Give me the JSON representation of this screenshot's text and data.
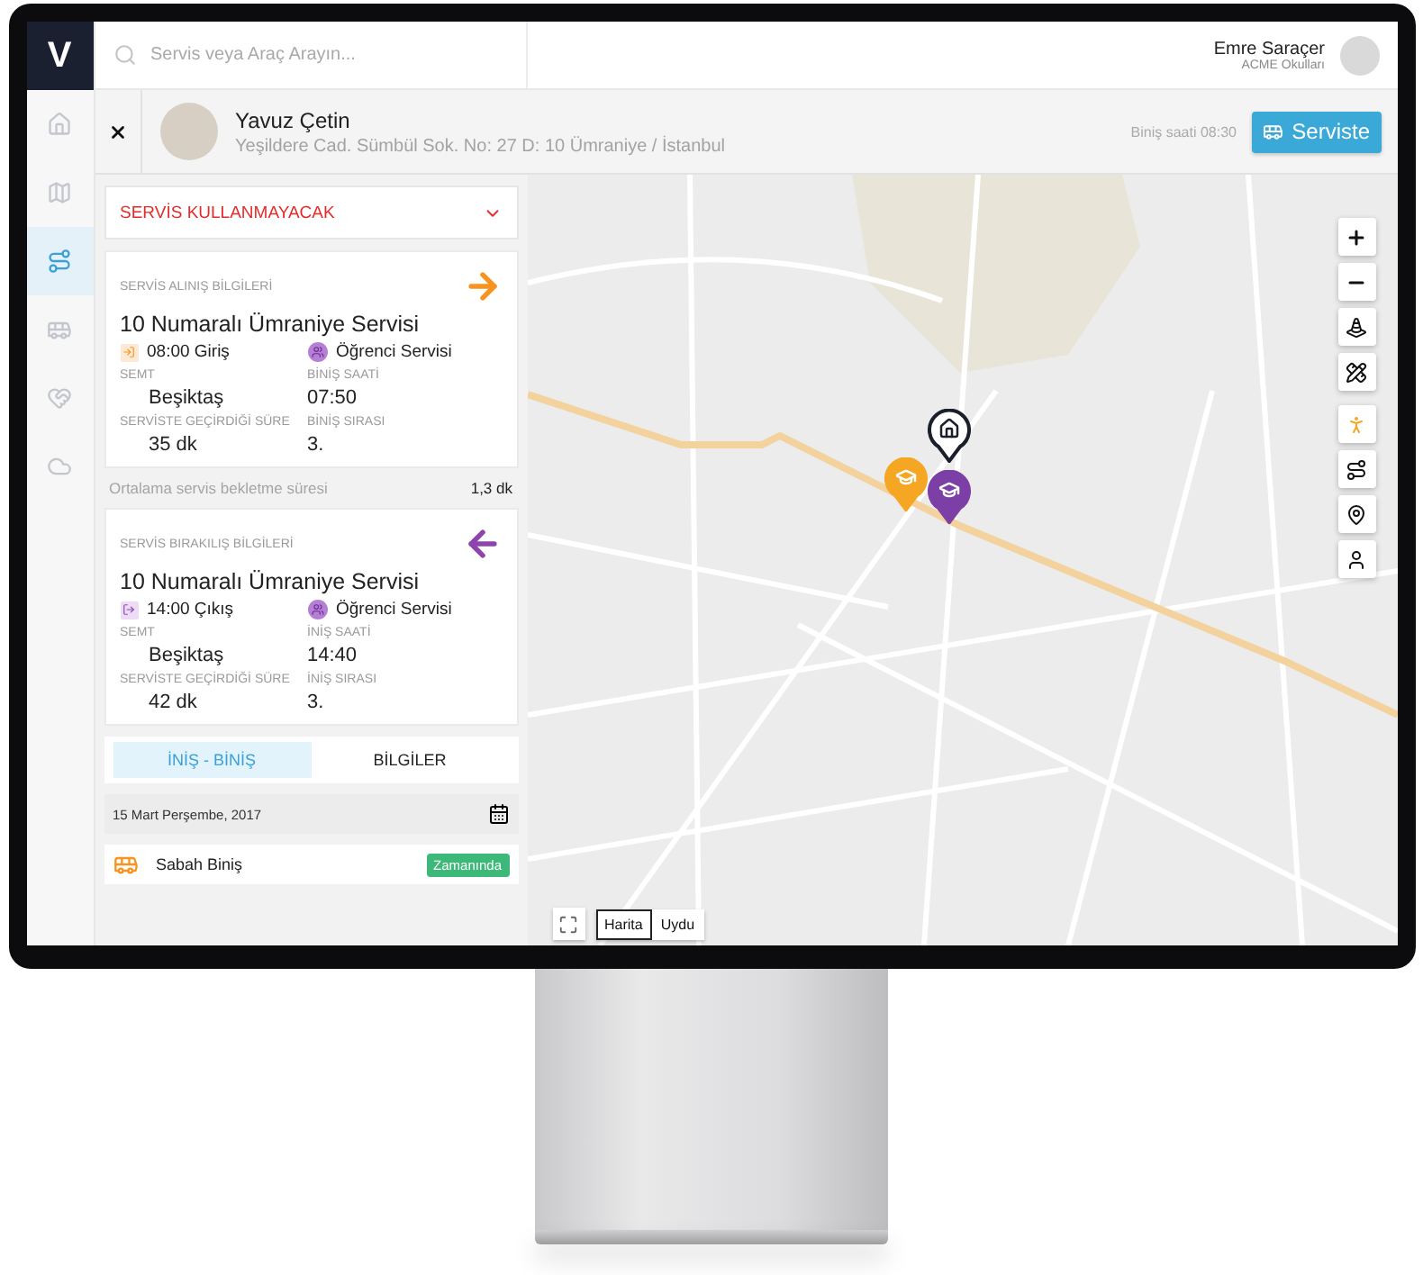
{
  "logo": "V",
  "sidebar": {
    "items": [
      {
        "selected": false
      },
      {
        "selected": false
      },
      {
        "selected": true
      },
      {
        "selected": false
      },
      {
        "selected": false
      },
      {
        "selected": false
      }
    ]
  },
  "search": {
    "placeholder": "Servis veya Araç Arayın..."
  },
  "user": {
    "name": "Emre Saraçer",
    "organization": "ACME Okulları"
  },
  "student": {
    "name": "Yavuz Çetin",
    "address": "Yeşildere Cad. Sümbül Sok. No: 27 D: 10 Ümraniye / İstanbul",
    "boarding_time": "Biniş saati 08:30",
    "status_button": "Serviste"
  },
  "service_select": {
    "value": "SERVİS KULLANMAYACAK"
  },
  "trips": [
    {
      "kind": "pickup",
      "heading": "SERVİS ALINIŞ BİLGİLERİ",
      "route": "10 Numaralı Ümraniye Servisi",
      "shift": "08:00 Giriş",
      "service_type": "Öğrenci Servisi",
      "fields": [
        {
          "label": "SEMT",
          "value": "Beşiktaş"
        },
        {
          "label": "BİNİŞ SAATİ",
          "value": "07:50"
        },
        {
          "label": "SERVİSTE GEÇİRDİĞİ SÜRE",
          "value": "35 dk"
        },
        {
          "label": "BİNİŞ SIRASI",
          "value": "3."
        }
      ]
    },
    {
      "kind": "dropoff",
      "heading": "SERVİS BIRAKILIŞ BİLGİLERİ",
      "route": "10 Numaralı Ümraniye Servisi",
      "shift": "14:00 Çıkış",
      "service_type": "Öğrenci Servisi",
      "fields": [
        {
          "label": "SEMT",
          "value": "Beşiktaş"
        },
        {
          "label": "İNİŞ SAATİ",
          "value": "14:40"
        },
        {
          "label": "SERVİSTE GEÇİRDİĞİ SÜRE",
          "value": "42 dk"
        },
        {
          "label": "İNİŞ SIRASI",
          "value": "3."
        }
      ]
    }
  ],
  "average_wait": {
    "label": "Ortalama servis bekletme süresi",
    "value": "1,3 dk"
  },
  "tabs": [
    {
      "label": "İNİŞ - BİNİŞ",
      "selected": true
    },
    {
      "label": "BİLGİLER",
      "selected": false
    }
  ],
  "log": {
    "date": "15 Mart Perşembe, 2017",
    "entries": [
      {
        "label": "Sabah Biniş",
        "status": "Zamanında"
      }
    ]
  },
  "map": {
    "markers": [
      {
        "kind": "home",
        "color": "#1b1f2a"
      },
      {
        "kind": "school",
        "color": "#f5a623"
      },
      {
        "kind": "school",
        "color": "#7b3fa6"
      }
    ],
    "type_options": [
      {
        "label": "Harita",
        "selected": true
      },
      {
        "label": "Uydu",
        "selected": false
      }
    ]
  }
}
